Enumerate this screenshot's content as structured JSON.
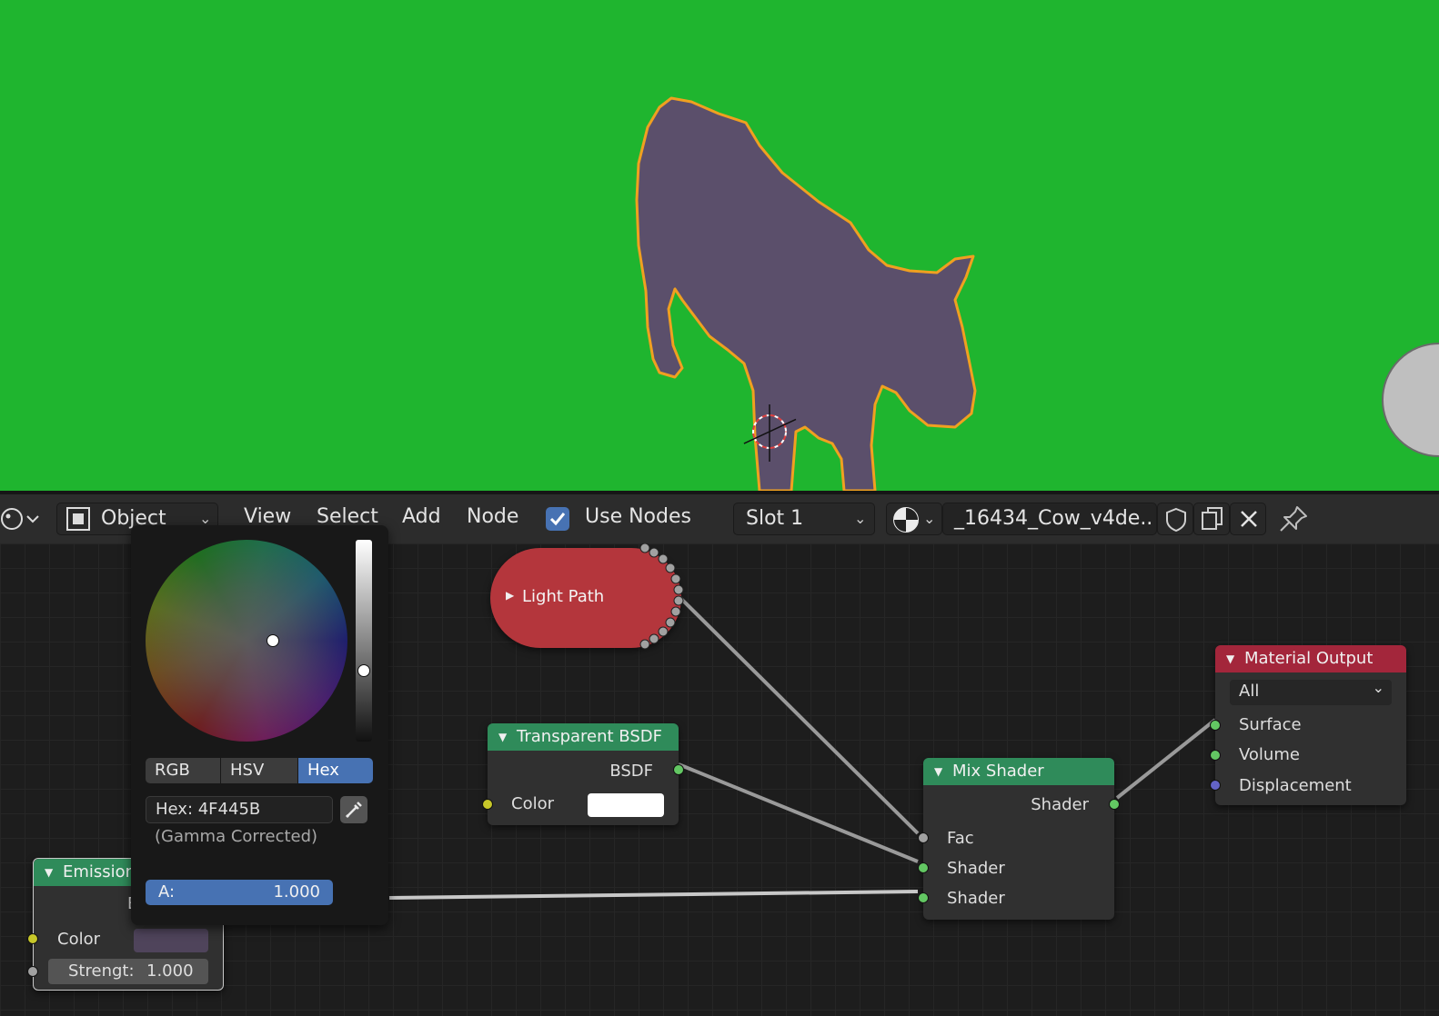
{
  "colors": {
    "viewport_bg": "#1fb52f",
    "cow_fill": "#5b4f6b",
    "cow_outline": "#f0a020",
    "node_light_path": "#b4363c",
    "node_shader": "#2f8b5a",
    "node_output": "#a3263b",
    "picker_active": "#4772b3",
    "hex_color": "#4F445B"
  },
  "header": {
    "mode_label": "Object",
    "menu": [
      "View",
      "Select",
      "Add",
      "Node"
    ],
    "use_nodes_label": "Use Nodes",
    "use_nodes_checked": true,
    "slot_label": "Slot 1",
    "material_name": "_16434_Cow_v4de.."
  },
  "color_picker": {
    "tabs": [
      "RGB",
      "HSV",
      "Hex"
    ],
    "active_tab": "Hex",
    "hex_field": "Hex: 4F445B",
    "gamma_note": "(Gamma Corrected)",
    "alpha_label": "A:",
    "alpha_value": "1.000"
  },
  "nodes": {
    "light_path": {
      "title": "Light Path"
    },
    "transparent_bsdf": {
      "title": "Transparent BSDF",
      "output": "BSDF",
      "input": "Color"
    },
    "mix_shader": {
      "title": "Mix Shader",
      "output": "Shader",
      "inputs": [
        "Fac",
        "Shader",
        "Shader"
      ]
    },
    "material_output": {
      "title": "Material Output",
      "target": "All",
      "inputs": [
        "Surface",
        "Volume",
        "Displacement"
      ]
    },
    "emission": {
      "title": "Emission",
      "output_partial": "E",
      "color_label": "Color",
      "strength_label": "Strengt:",
      "strength_value": "1.000"
    }
  }
}
